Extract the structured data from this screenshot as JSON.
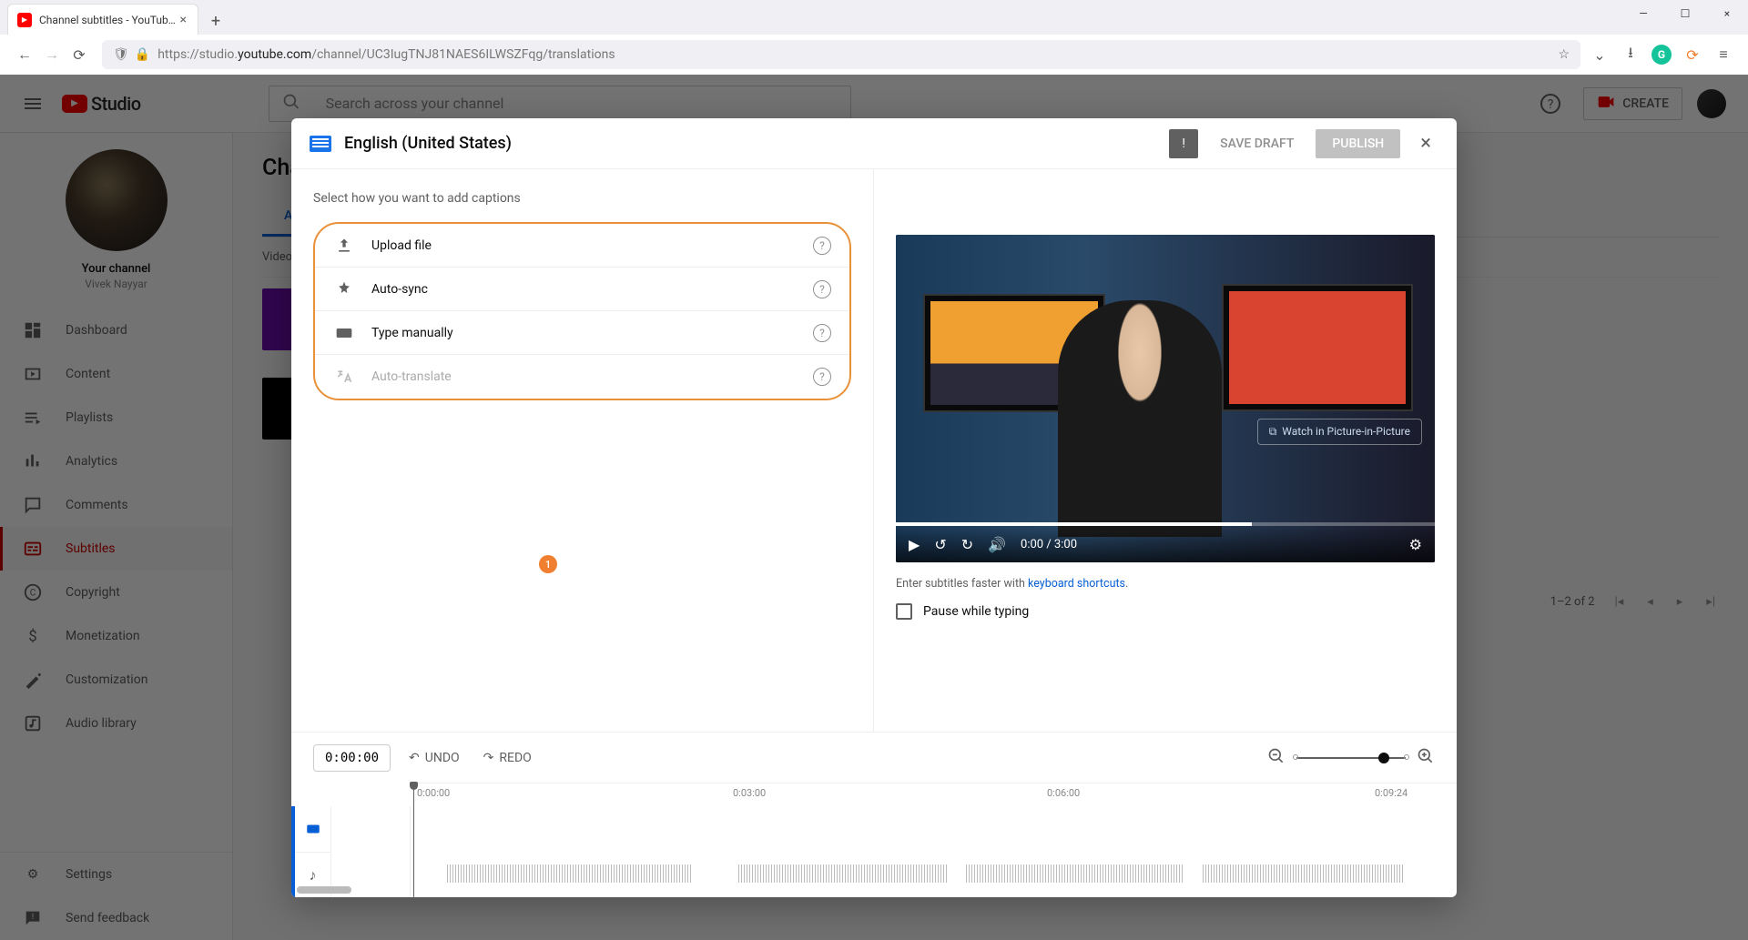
{
  "browser": {
    "tab_title": "Channel subtitles - YouTube Stu",
    "url_prefix": "https://studio.",
    "url_domain": "youtube.com",
    "url_path": "/channel/UC3IugTNJ81NAES6ILWSZFqg/translations"
  },
  "header": {
    "logo_text": "Studio",
    "search_placeholder": "Search across your channel",
    "create_label": "CREATE"
  },
  "sidebar": {
    "your_channel": "Your channel",
    "channel_name": "Vivek Nayyar",
    "items": [
      {
        "label": "Dashboard"
      },
      {
        "label": "Content"
      },
      {
        "label": "Playlists"
      },
      {
        "label": "Analytics"
      },
      {
        "label": "Comments"
      },
      {
        "label": "Subtitles"
      },
      {
        "label": "Copyright"
      },
      {
        "label": "Monetization"
      },
      {
        "label": "Customization"
      },
      {
        "label": "Audio library"
      }
    ],
    "settings": "Settings",
    "feedback": "Send feedback"
  },
  "background": {
    "page_title_partial": "Cha",
    "tab_all": "All",
    "col_video": "Video",
    "pager_text": "1–2 of 2"
  },
  "modal": {
    "title": "English (United States)",
    "save_draft": "SAVE DRAFT",
    "publish": "PUBLISH",
    "prompt": "Select how you want to add captions",
    "options": [
      {
        "label": "Upload file",
        "enabled": true
      },
      {
        "label": "Auto-sync",
        "enabled": true
      },
      {
        "label": "Type manually",
        "enabled": true
      },
      {
        "label": "Auto-translate",
        "enabled": false
      }
    ],
    "annotation_badge": "1",
    "pip_label": "Watch in Picture-in-Picture",
    "video_time": "0:00 / 3:00",
    "hint_prefix": "Enter subtitles faster with ",
    "hint_link": "keyboard shortcuts",
    "hint_suffix": ".",
    "pause_label": "Pause while typing",
    "timeline": {
      "time_value": "0:00:00",
      "undo": "UNDO",
      "redo": "REDO",
      "marks": [
        "0:00:00",
        "0:03:00",
        "0:06:00",
        "0:09:24"
      ]
    }
  }
}
